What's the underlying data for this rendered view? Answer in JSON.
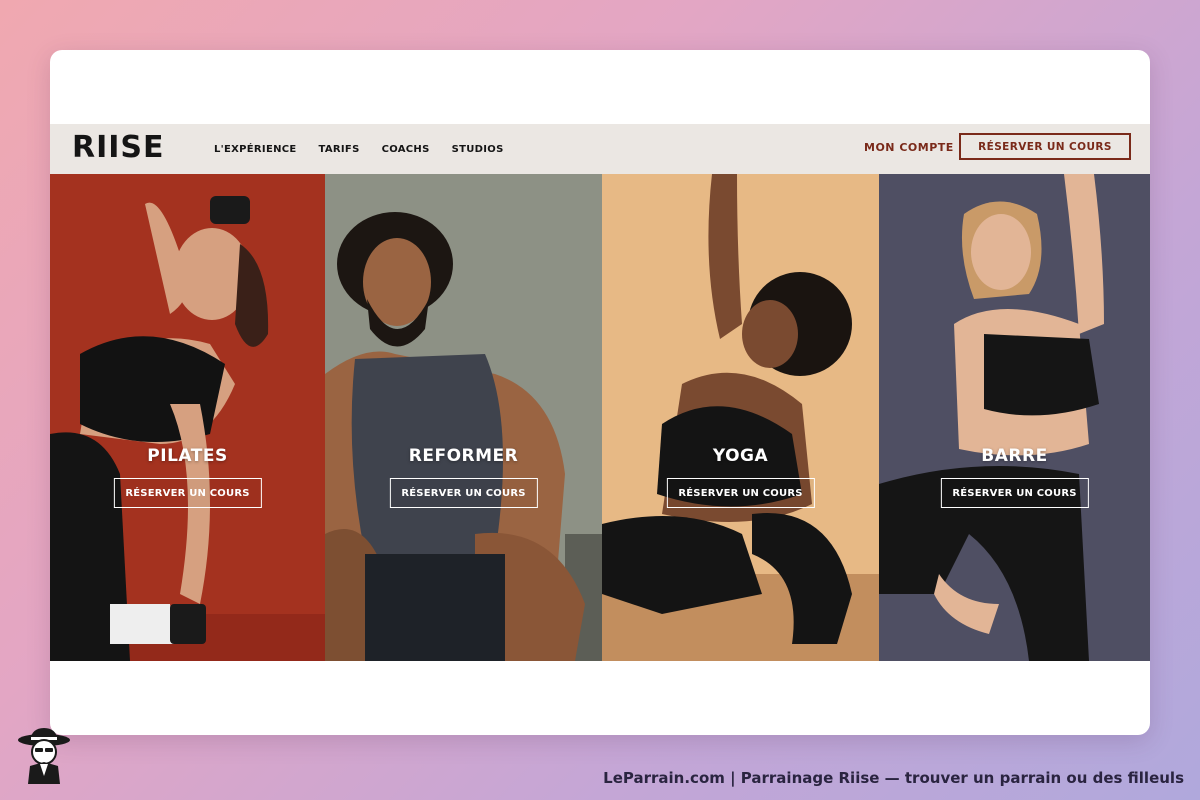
{
  "brand": {
    "logo_text": "RIISE"
  },
  "nav": {
    "links": [
      "L'EXPÉRIENCE",
      "TARIFS",
      "COACHS",
      "STUDIOS"
    ],
    "account": "MON COMPTE",
    "cta": "RÉSERVER UN COURS"
  },
  "panels": [
    {
      "title": "PILATES",
      "button": "RÉSERVER UN COURS",
      "bg": "#a4321f"
    },
    {
      "title": "REFORMER",
      "button": "RÉSERVER UN COURS",
      "bg": "#8d9185"
    },
    {
      "title": "YOGA",
      "button": "RÉSERVER UN COURS",
      "bg": "#e7b985"
    },
    {
      "title": "BARRE",
      "button": "RÉSERVER UN COURS",
      "bg": "#4f4f63"
    }
  ],
  "footer": {
    "caption": "LeParrain.com | Parrainage Riise — trouver un parrain ou des filleuls"
  },
  "colors": {
    "accent": "#7a2a1a",
    "navbar_bg": "#ebe7e3"
  },
  "icons": {
    "mascot": "detective-mascot-icon"
  }
}
